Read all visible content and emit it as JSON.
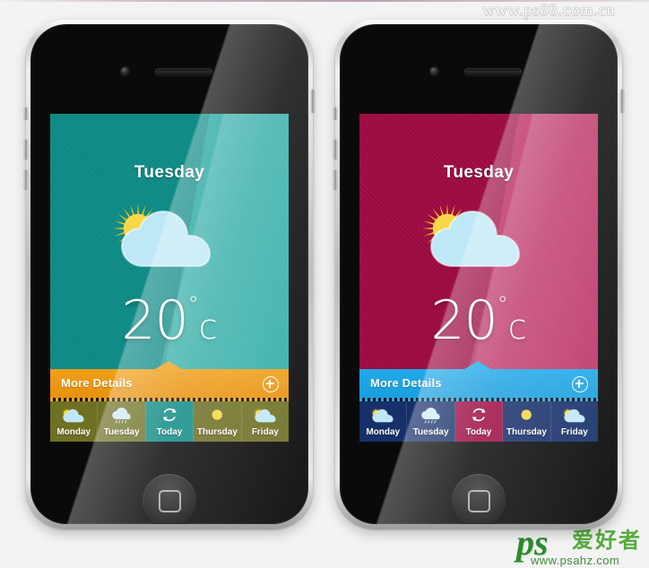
{
  "page": {
    "background_color": "#f4f3f3",
    "watermark": "www.ps88.com.cn",
    "logo": {
      "mark": "ps",
      "cn": "爱好者",
      "url": "www.psahz.com",
      "color": "#2f8a2f"
    }
  },
  "phones": [
    {
      "id": "phone-teal",
      "theme": {
        "hero_from": "#0e8a85",
        "hero_to": "#18a39b",
        "details_bar": "#f0a01a",
        "details_bar_to": "#e8920f",
        "week_bar": "#6e7024",
        "active_tile": "#0e8a85",
        "dot_color": "#f0a01a"
      },
      "screen": {
        "day": "Tuesday",
        "temperature": "20",
        "degree_symbol": "°",
        "unit": "c",
        "condition_icon": "sun-behind-cloud-icon",
        "details_label": "More Details",
        "add_icon": "plus-circle-icon"
      },
      "week": [
        {
          "label": "Monday",
          "icon": "sun-behind-cloud-icon",
          "active": false
        },
        {
          "label": "Tuesday",
          "icon": "rain-cloud-icon",
          "active": false
        },
        {
          "label": "Today",
          "icon": "refresh-icon",
          "active": true
        },
        {
          "label": "Thursday",
          "icon": "sun-icon",
          "active": false
        },
        {
          "label": "Friday",
          "icon": "sun-behind-cloud-icon",
          "active": false
        }
      ]
    },
    {
      "id": "phone-crimson",
      "theme": {
        "hero_from": "#9c0b42",
        "hero_to": "#b51a56",
        "details_bar": "#21a9e8",
        "details_bar_to": "#1a9ede",
        "week_bar": "#17306b",
        "active_tile": "#9c0b42",
        "dot_color": "#21a9e8"
      },
      "screen": {
        "day": "Tuesday",
        "temperature": "20",
        "degree_symbol": "°",
        "unit": "c",
        "condition_icon": "sun-behind-cloud-icon",
        "details_label": "More Details",
        "add_icon": "plus-circle-icon"
      },
      "week": [
        {
          "label": "Monday",
          "icon": "sun-behind-cloud-icon",
          "active": false
        },
        {
          "label": "Tuesday",
          "icon": "rain-cloud-icon",
          "active": false
        },
        {
          "label": "Today",
          "icon": "refresh-icon",
          "active": true
        },
        {
          "label": "Thursday",
          "icon": "sun-icon",
          "active": false
        },
        {
          "label": "Friday",
          "icon": "sun-behind-cloud-icon",
          "active": false
        }
      ]
    }
  ]
}
